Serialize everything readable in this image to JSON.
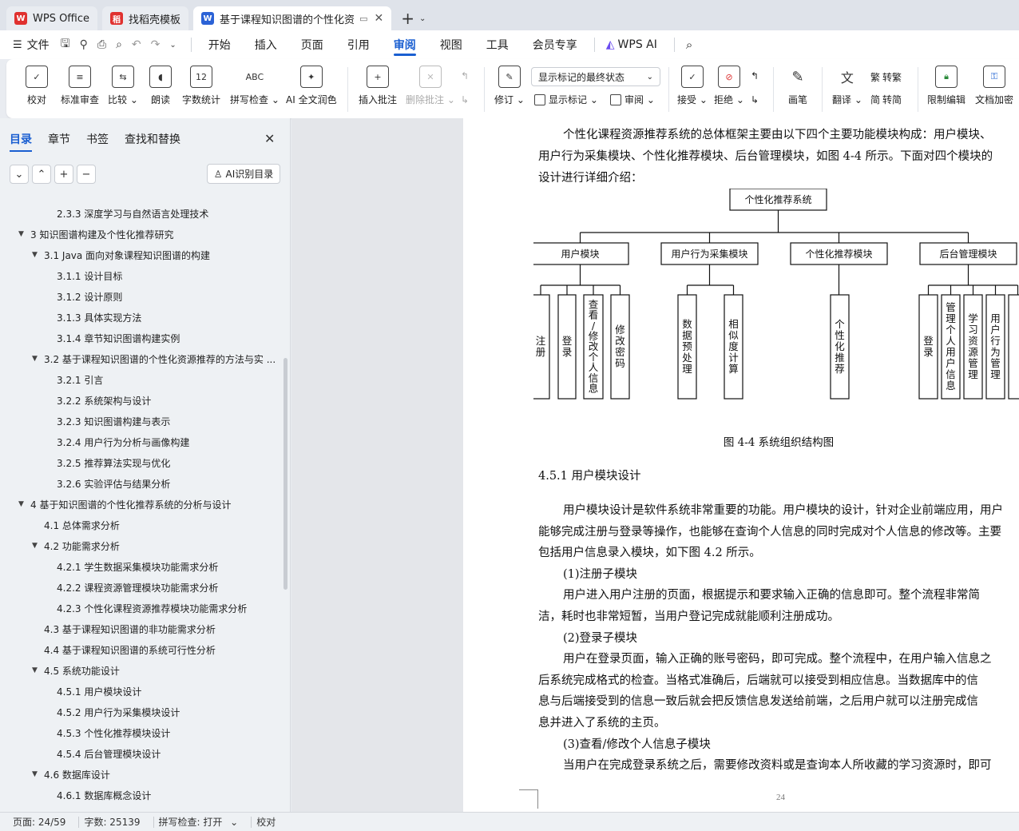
{
  "tabs": [
    {
      "label": "WPS Office",
      "icon": "wps-logo-icon",
      "color": "#e0312f"
    },
    {
      "label": "找稻壳模板",
      "icon": "docer-logo-icon",
      "color": "#e0312f"
    },
    {
      "label": "基于课程知识图谱的个性化资",
      "icon": "word-doc-icon",
      "color": "#2b62d6"
    }
  ],
  "menubar": {
    "file": "文件",
    "items": [
      "开始",
      "插入",
      "页面",
      "引用",
      "审阅",
      "视图",
      "工具",
      "会员专享"
    ],
    "active": "审阅",
    "wps_ai": "WPS AI"
  },
  "ribbon": {
    "proofread": "校对",
    "std_review": "标准审查",
    "compare": "比较",
    "read_aloud": "朗读",
    "word_count": "字数统计",
    "spell_check": "拼写检查",
    "ai_proof": "AI 全文润色",
    "insert_comment": "插入批注",
    "delete_comment": "删除批注",
    "revise": "修订",
    "markup_select": "显示标记的最终状态",
    "show_markup": "显示标记",
    "review": "审阅",
    "accept": "接受",
    "reject": "拒绝",
    "pen": "画笔",
    "translate": "翻译",
    "to_traditional": "转繁",
    "to_simplified": "转简",
    "restrict_edit": "限制编辑",
    "encrypt": "文档加密"
  },
  "sidebar": {
    "tabs": [
      "目录",
      "章节",
      "书签",
      "查找和替换"
    ],
    "active": "目录",
    "ai_toc": "AI识别目录",
    "toc": [
      {
        "text": "2.3.3  深度学习与自然语言处理技术",
        "level": 3,
        "arrow": false
      },
      {
        "text": "3  知识图谱构建及个性化推荐研究",
        "level": 1,
        "arrow": true
      },
      {
        "text": "3.1 Java 面向对象课程知识图谱的构建",
        "level": 2,
        "arrow": true
      },
      {
        "text": "3.1.1  设计目标",
        "level": 3,
        "arrow": false
      },
      {
        "text": "3.1.2  设计原则",
        "level": 3,
        "arrow": false
      },
      {
        "text": "3.1.3  具体实现方法",
        "level": 3,
        "arrow": false
      },
      {
        "text": "3.1.4  章节知识图谱构建实例",
        "level": 3,
        "arrow": false
      },
      {
        "text": "3.2  基于课程知识图谱的个性化资源推荐的方法与实 ...",
        "level": 2,
        "arrow": true
      },
      {
        "text": "3.2.1  引言",
        "level": 3,
        "arrow": false
      },
      {
        "text": "3.2.2  系统架构与设计",
        "level": 3,
        "arrow": false
      },
      {
        "text": "3.2.3  知识图谱构建与表示",
        "level": 3,
        "arrow": false
      },
      {
        "text": "3.2.4  用户行为分析与画像构建",
        "level": 3,
        "arrow": false
      },
      {
        "text": "3.2.5  推荐算法实现与优化",
        "level": 3,
        "arrow": false
      },
      {
        "text": "3.2.6  实验评估与结果分析",
        "level": 3,
        "arrow": false
      },
      {
        "text": "4  基于知识图谱的个性化推荐系统的分析与设计",
        "level": 1,
        "arrow": true
      },
      {
        "text": "4.1  总体需求分析",
        "level": 2,
        "arrow": false
      },
      {
        "text": "4.2  功能需求分析",
        "level": 2,
        "arrow": true
      },
      {
        "text": "4.2.1 学生数据采集模块功能需求分析",
        "level": 3,
        "arrow": false
      },
      {
        "text": "4.2.2 课程资源管理模块功能需求分析",
        "level": 3,
        "arrow": false
      },
      {
        "text": "4.2.3 个性化课程资源推荐模块功能需求分析",
        "level": 3,
        "arrow": false
      },
      {
        "text": "4.3  基于课程知识图谱的非功能需求分析",
        "level": 2,
        "arrow": false
      },
      {
        "text": "4.4  基于课程知识图谱的系统可行性分析",
        "level": 2,
        "arrow": false
      },
      {
        "text": "4.5  系统功能设计",
        "level": 2,
        "arrow": true
      },
      {
        "text": "4.5.1  用户模块设计",
        "level": 3,
        "arrow": false
      },
      {
        "text": "4.5.2  用户行为采集模块设计",
        "level": 3,
        "arrow": false
      },
      {
        "text": "4.5.3  个性化推荐模块设计",
        "level": 3,
        "arrow": false
      },
      {
        "text": "4.5.4  后台管理模块设计",
        "level": 3,
        "arrow": false
      },
      {
        "text": "4.6  数据库设计",
        "level": 2,
        "arrow": true
      },
      {
        "text": "4.6.1  数据库概念设计",
        "level": 3,
        "arrow": false
      }
    ]
  },
  "document": {
    "intro_lines": [
      "个性化课程资源推荐系统的总体框架主要由以下四个主要功能模块构成：用户模块、",
      "用户行为采集模块、个性化推荐模块、后台管理模块，如图 4-4 所示。下面对四个模块的",
      "设计进行详细介绍："
    ],
    "figure": {
      "root": "个性化推荐系统",
      "modules": [
        {
          "name": "用户模块",
          "leaves": [
            "注册",
            "登录",
            "查看/修改个人信息",
            "修改密码"
          ]
        },
        {
          "name": "用户行为采集模块",
          "leaves": [
            "数据预处理",
            "相似度计算"
          ]
        },
        {
          "name": "个性化推荐模块",
          "leaves": [
            "个性化推荐"
          ]
        },
        {
          "name": "后台管理模块",
          "leaves": [
            "登录",
            "管理个人用户信息",
            "学习资源管理",
            "用户行为管理",
            ""
          ]
        }
      ],
      "caption": "图 4-4  系统组织结构图"
    },
    "section_title": "4.5.1  用户模块设计",
    "body_lines": [
      {
        "text": "用户模块设计是软件系统非常重要的功能。用户模块的设计，针对企业前端应用，用户",
        "indent": true
      },
      {
        "text": "能够完成注册与登录等操作，也能够在查询个人信息的同时完成对个人信息的修改等。主要",
        "indent": false
      },
      {
        "text": "包括用户信息录入模块，如下图 4.2 所示。",
        "indent": false
      },
      {
        "text": "(1)注册子模块",
        "indent": true
      },
      {
        "text": "用户进入用户注册的页面，根据提示和要求输入正确的信息即可。整个流程非常简",
        "indent": true
      },
      {
        "text": "洁，耗时也非常短暂，当用户登记完成就能顺利注册成功。",
        "indent": false
      },
      {
        "text": "(2)登录子模块",
        "indent": true
      },
      {
        "text": "用户在登录页面，输入正确的账号密码，即可完成。整个流程中，在用户输入信息之",
        "indent": true
      },
      {
        "text": "后系统完成格式的检查。当格式准确后，后端就可以接受到相应信息。当数据库中的信",
        "indent": false
      },
      {
        "text": "息与后端接受到的信息一致后就会把反馈信息发送给前端，之后用户就可以注册完成信",
        "indent": false
      },
      {
        "text": "息并进入了系统的主页。",
        "indent": false
      },
      {
        "text": "(3)查看/修改个人信息子模块",
        "indent": true
      },
      {
        "text": "当用户在完成登录系统之后，需要修改资料或是查询本人所收藏的学习资源时，即可",
        "indent": true
      }
    ],
    "page_number": "24"
  },
  "status": {
    "page": "页面: 24/59",
    "words": "字数: 25139",
    "spell": "拼写检查: 打开",
    "proof": "校对"
  }
}
